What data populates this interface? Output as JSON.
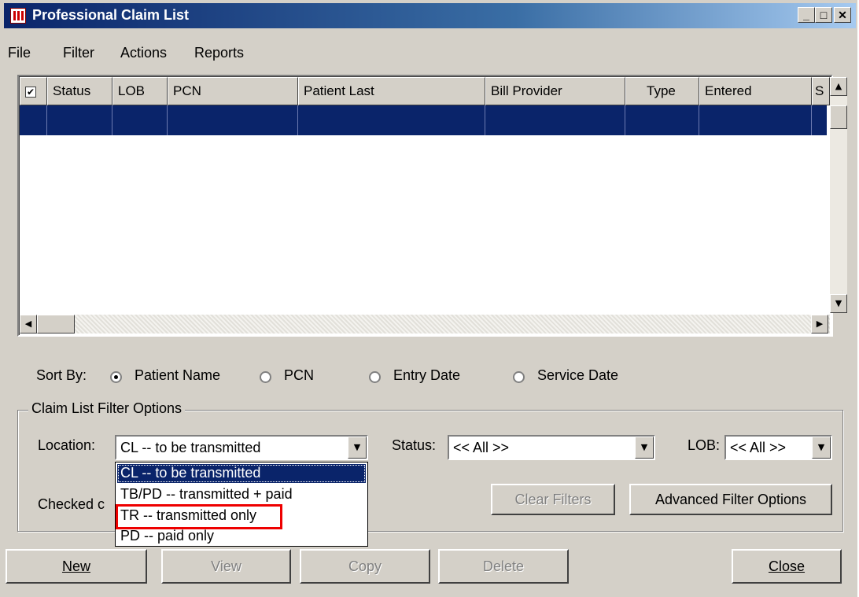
{
  "window": {
    "title": "Professional Claim List"
  },
  "menu": [
    "File",
    "Filter",
    "Actions",
    "Reports"
  ],
  "grid": {
    "columns": [
      "Status",
      "LOB",
      "PCN",
      "Patient Last",
      "Bill Provider",
      "Type",
      "Entered",
      "S"
    ],
    "header_checkbox": "✔"
  },
  "sort": {
    "label": "Sort By:",
    "options": [
      "Patient Name",
      "PCN",
      "Entry Date",
      "Service Date"
    ],
    "selected": "Patient Name"
  },
  "filters": {
    "group_title": "Claim List Filter Options",
    "location_label": "Location:",
    "location_value": "CL -- to be transmitted",
    "location_options": [
      "CL -- to be transmitted",
      "TB/PD -- transmitted + paid",
      "TR -- transmitted only",
      "PD -- paid only"
    ],
    "status_label": "Status:",
    "status_value": "<< All >>",
    "lob_label": "LOB:",
    "lob_value": "<< All >>",
    "checked_label": "Checked c",
    "clear_button": "Clear Filters",
    "advanced_button": "Advanced Filter Options"
  },
  "actions": {
    "new": "New",
    "view": "View",
    "copy": "Copy",
    "delete": "Delete",
    "close": "Close"
  },
  "colors": {
    "title_bar": "#0a246a",
    "selection": "#0a246a",
    "highlight": "#e00000",
    "face": "#d4d0c8"
  }
}
